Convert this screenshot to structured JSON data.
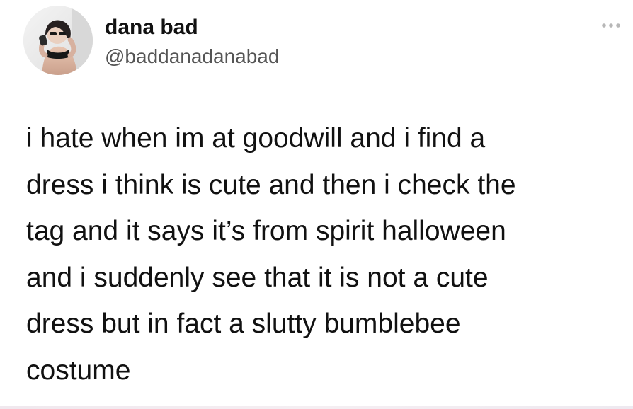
{
  "tweet": {
    "author": {
      "display_name": "dana bad",
      "handle": "@baddanadanabad",
      "avatar_icon": "profile-photo-avatar"
    },
    "more_icon": "more-options-icon",
    "text": "i hate when im at goodwill and i find a\ndress i think is cute and then i check the\ntag and it says it’s from spirit halloween\nand i suddenly see that it is not a cute\ndress but in fact a slutty bumblebee\ncostume"
  },
  "colors": {
    "background": "#ffffff",
    "text": "#111111",
    "secondary_text": "#555555",
    "icon": "#b7b7b7"
  }
}
